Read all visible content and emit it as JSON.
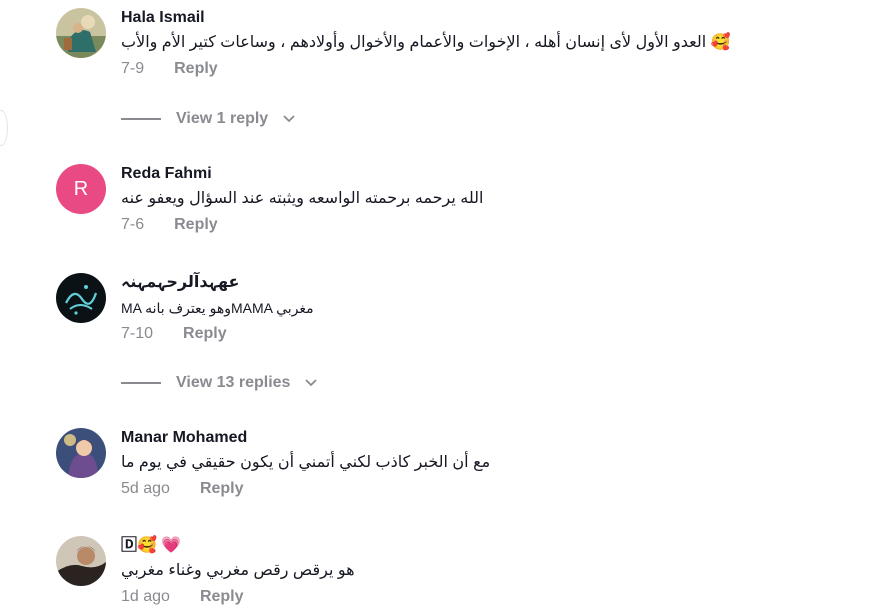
{
  "comments": [
    {
      "username": "Hala Ismail",
      "avatar_icon": "woman-painting-avatar",
      "text": "العدو الأول لأى إنسان أهله ، الإخوات والأعمام والأخوال وأولادهم ، وساعات كتير الأم والأب 🥰",
      "date": "7-9",
      "reply_label": "Reply"
    },
    {
      "username": "Reda Fahmi",
      "avatar_letter": "R",
      "avatar_color": "#ea4a83",
      "text": "الله يرحمه برحمته الواسعه ويثبته عند السؤال ويعفو عنه",
      "date": "7-6",
      "reply_label": "Reply"
    },
    {
      "username": "عهہدآلرحہمہنہ",
      "avatar_icon": "arabic-calligraphy-avatar",
      "text": "MA وهو يعترف بانهMAMA مغربي",
      "date": "7-10",
      "reply_label": "Reply"
    },
    {
      "username": "Manar Mohamed",
      "avatar_icon": "girl-illustration-avatar",
      "text": "مع أن الخبر كاذب لكني أتمني أن يكون حقيقي في يوم ما",
      "date": "5d ago",
      "reply_label": "Reply"
    },
    {
      "username": "🄳🥰 💗",
      "avatar_icon": "person-photo-avatar",
      "text": "هو يرقص رقص مغربي وغناء مغربي",
      "date": "1d ago",
      "reply_label": "Reply"
    }
  ],
  "view_replies": [
    {
      "label": "View 1 reply"
    },
    {
      "label": "View 13 replies"
    }
  ],
  "colors": {
    "text": "#161823",
    "muted": "#8a8b91",
    "avatar_letter_bg": "#ea4a83"
  }
}
